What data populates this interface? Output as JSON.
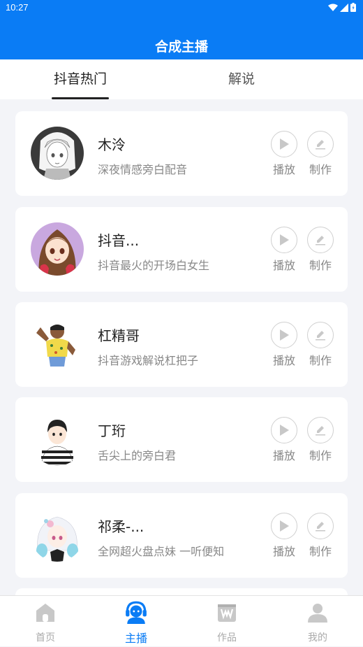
{
  "status_bar": {
    "time": "10:27"
  },
  "header": {
    "title": "合成主播"
  },
  "tabs": [
    {
      "label": "抖音热门",
      "active": true
    },
    {
      "label": "解说",
      "active": false
    }
  ],
  "anchors": [
    {
      "name": "木泠",
      "desc": "深夜情感旁白配音",
      "avatar": "anime-girl-sketch"
    },
    {
      "name": "抖音...",
      "desc": "抖音最火的开场白女生",
      "avatar": "anime-girl-brown-hair"
    },
    {
      "name": "杠精哥",
      "desc": "抖音游戏解说杠把子",
      "avatar": "muscle-man-cartoon"
    },
    {
      "name": "丁珩",
      "desc": "舌尖上的旁白君",
      "avatar": "boy-striped-shirt"
    },
    {
      "name": "祁柔-...",
      "desc": "全网超火盘点妹 一听便知",
      "avatar": "anime-girl-white-hair"
    }
  ],
  "actions": {
    "play_label": "播放",
    "make_label": "制作"
  },
  "bottom_nav": [
    {
      "label": "首页",
      "icon": "home-icon",
      "active": false
    },
    {
      "label": "主播",
      "icon": "headset-icon",
      "active": true
    },
    {
      "label": "作品",
      "icon": "works-icon",
      "active": false
    },
    {
      "label": "我的",
      "icon": "profile-icon",
      "active": false
    }
  ],
  "colors": {
    "accent": "#0a7cf5",
    "inactive": "#aaaaaa"
  }
}
